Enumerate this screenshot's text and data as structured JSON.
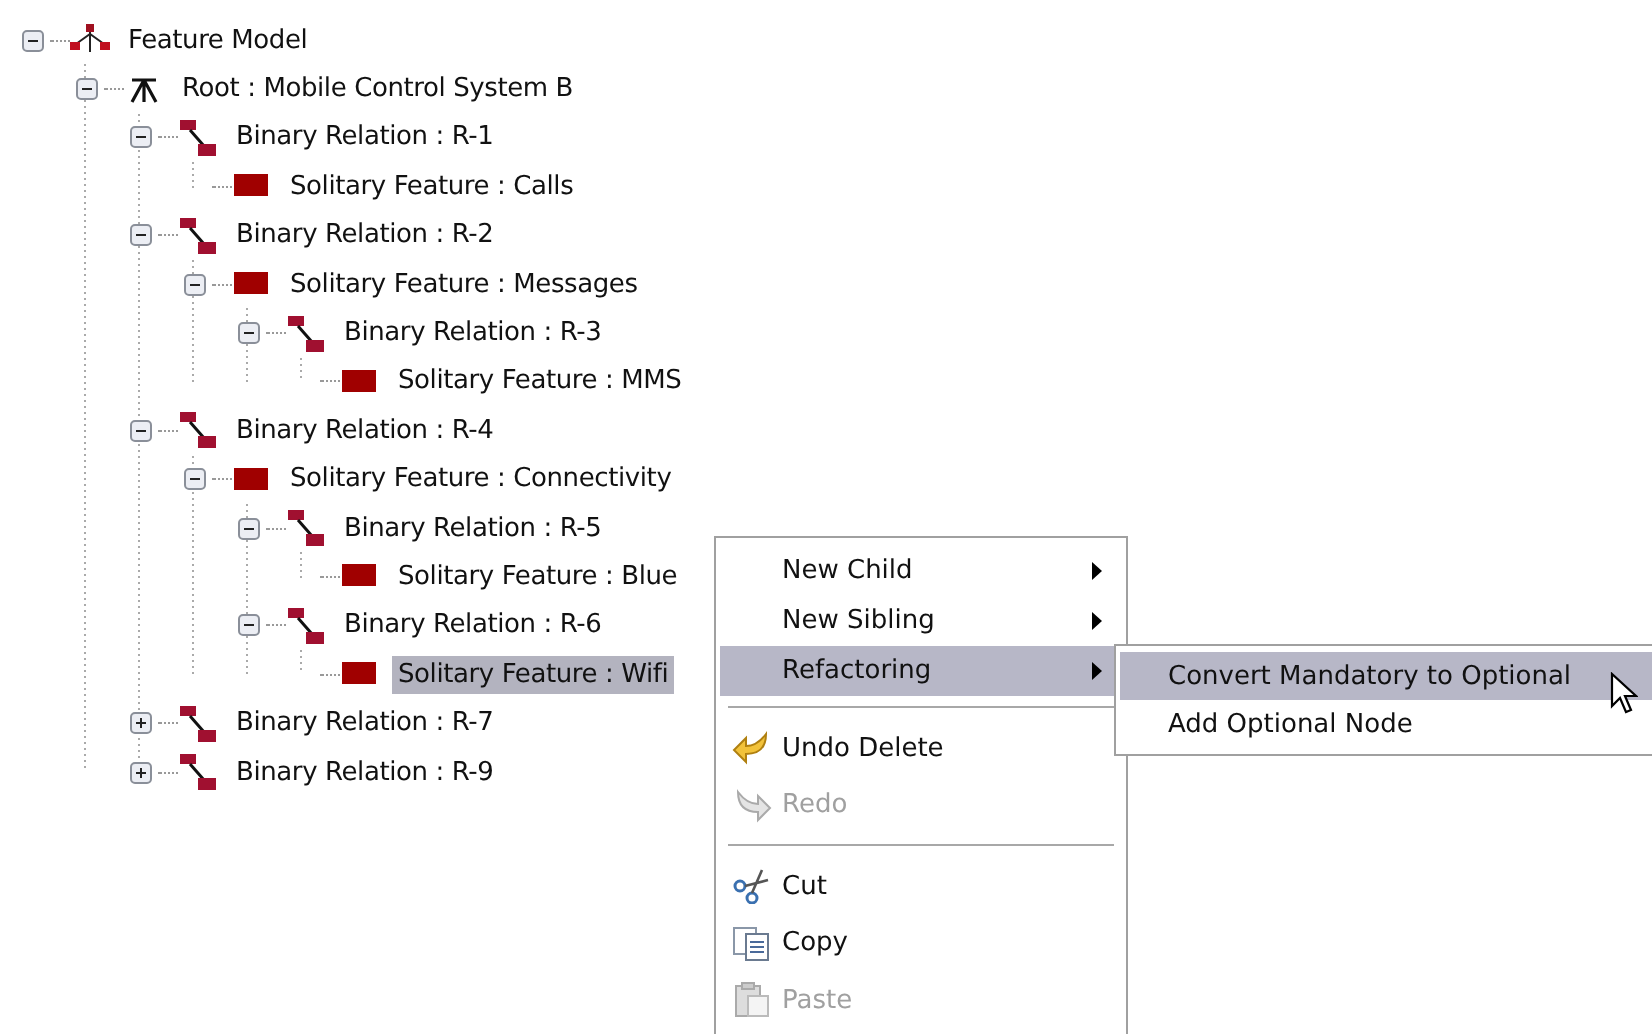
{
  "tree": [
    {
      "kind": "model",
      "label": "Feature Model",
      "expanded": true,
      "selected": false,
      "children": [
        {
          "kind": "root",
          "label": "Root : Mobile Control System B",
          "expanded": true,
          "selected": false,
          "children": [
            {
              "kind": "relation",
              "label": "Binary Relation : R-1",
              "expanded": true,
              "selected": false,
              "children": [
                {
                  "kind": "feature",
                  "label": "Solitary Feature : Calls",
                  "selected": false
                }
              ]
            },
            {
              "kind": "relation",
              "label": "Binary Relation : R-2",
              "expanded": true,
              "selected": false,
              "children": [
                {
                  "kind": "feature",
                  "label": "Solitary Feature : Messages",
                  "expanded": true,
                  "selected": false,
                  "children": [
                    {
                      "kind": "relation",
                      "label": "Binary Relation : R-3",
                      "expanded": true,
                      "selected": false,
                      "children": [
                        {
                          "kind": "feature",
                          "label": "Solitary Feature : MMS",
                          "selected": false
                        }
                      ]
                    }
                  ]
                }
              ]
            },
            {
              "kind": "relation",
              "label": "Binary Relation : R-4",
              "expanded": true,
              "selected": false,
              "children": [
                {
                  "kind": "feature",
                  "label": "Solitary Feature : Connectivity",
                  "expanded": true,
                  "selected": false,
                  "children": [
                    {
                      "kind": "relation",
                      "label": "Binary Relation : R-5",
                      "expanded": true,
                      "selected": false,
                      "children": [
                        {
                          "kind": "feature",
                          "label": "Solitary Feature : Blue",
                          "selected": false
                        }
                      ]
                    },
                    {
                      "kind": "relation",
                      "label": "Binary Relation : R-6",
                      "expanded": true,
                      "selected": false,
                      "children": [
                        {
                          "kind": "feature",
                          "label": "Solitary Feature : Wifi",
                          "selected": true
                        }
                      ]
                    }
                  ]
                }
              ]
            },
            {
              "kind": "relation",
              "label": "Binary Relation : R-7",
              "expanded": false,
              "selected": false
            },
            {
              "kind": "relation",
              "label": "Binary Relation : R-9",
              "expanded": false,
              "selected": false
            }
          ]
        }
      ]
    }
  ],
  "context_menu": {
    "items": [
      {
        "kind": "submenu",
        "label": "New Child",
        "selected": false,
        "disabled": false
      },
      {
        "kind": "submenu",
        "label": "New Sibling",
        "selected": false,
        "disabled": false
      },
      {
        "kind": "submenu",
        "label": "Refactoring",
        "selected": true,
        "disabled": false
      },
      {
        "kind": "separator"
      },
      {
        "kind": "undo",
        "label": "Undo Delete",
        "selected": false,
        "disabled": false
      },
      {
        "kind": "redo",
        "label": "Redo",
        "selected": false,
        "disabled": true
      },
      {
        "kind": "separator"
      },
      {
        "kind": "cut",
        "label": "Cut",
        "selected": false,
        "disabled": false
      },
      {
        "kind": "copy",
        "label": "Copy",
        "selected": false,
        "disabled": false
      },
      {
        "kind": "paste",
        "label": "Paste",
        "selected": false,
        "disabled": true
      }
    ]
  },
  "submenu": {
    "items": [
      {
        "label": "Convert Mandatory to Optional",
        "selected": true
      },
      {
        "label": "Add Optional Node",
        "selected": false
      }
    ]
  }
}
